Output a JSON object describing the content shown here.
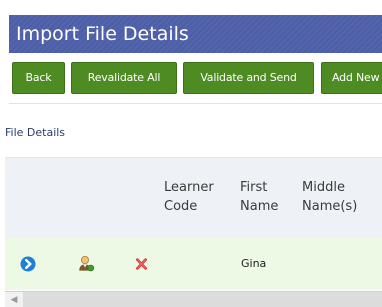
{
  "header": {
    "title": "Import File Details"
  },
  "toolbar": {
    "back_label": "Back",
    "revalidate_label": "Revalidate All",
    "validate_send_label": "Validate and Send",
    "add_new_label": "Add New"
  },
  "section": {
    "label": "File Details"
  },
  "grid": {
    "columns": {
      "learner_code": "Learner\nCode",
      "first_name": "First\nName",
      "middle_names": "Middle\nName(s)"
    },
    "rows": [
      {
        "learner_code": "",
        "first_name": "Gina",
        "middle_names": ""
      }
    ]
  },
  "colors": {
    "title_bar": "#4c5ea7",
    "button": "#4e8b22",
    "row_highlight": "#edf8e5",
    "header_bg": "#eef2f6"
  },
  "icons": {
    "row_open": "circle-arrow-right-icon",
    "row_learner": "learner-user-icon",
    "row_delete": "delete-x-icon",
    "scroll_left": "chevron-left-icon"
  }
}
